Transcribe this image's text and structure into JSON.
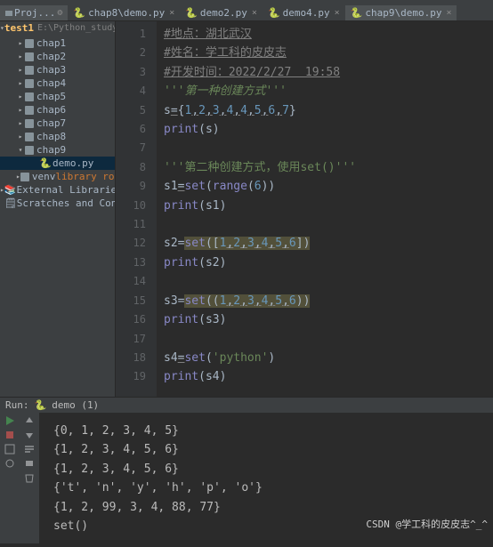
{
  "toolbar": {
    "project_label": "Proj..."
  },
  "tabs": [
    {
      "label": "chap8\\demo.py"
    },
    {
      "label": "demo2.py"
    },
    {
      "label": "demo4.py"
    },
    {
      "label": "chap9\\demo.py",
      "active": true
    }
  ],
  "tree": {
    "root": {
      "name": "test1",
      "path": "E:\\Python_study\\te"
    },
    "items": [
      {
        "name": "chap1"
      },
      {
        "name": "chap2"
      },
      {
        "name": "chap3"
      },
      {
        "name": "chap4"
      },
      {
        "name": "chap5"
      },
      {
        "name": "chap6"
      },
      {
        "name": "chap7"
      },
      {
        "name": "chap8"
      },
      {
        "name": "chap9",
        "open": true,
        "children": [
          {
            "name": "demo.py",
            "selected": true
          }
        ]
      }
    ],
    "venv": {
      "name": "venv",
      "suffix": "library root"
    },
    "ext": "External Libraries",
    "scratches": "Scratches and Consoles"
  },
  "gutter": [
    "1",
    "2",
    "3",
    "4",
    "5",
    "6",
    "7",
    "8",
    "9",
    "10",
    "11",
    "12",
    "13",
    "14",
    "15",
    "16",
    "17",
    "18",
    "19"
  ],
  "code": {
    "l1a": "#地点：湖北武汉",
    "l2a": "#姓名：学工科的皮皮志",
    "l3a": "#开发时间：2022/2/27  19:58",
    "l4": "'''第一种创建方式'''",
    "l5_var": "s",
    "eq": "=",
    "br_l": "{",
    "br_r": "}",
    "comma": ",",
    "n1": "1",
    "n2": "2",
    "n3": "3",
    "n4": "4",
    "n4b": "4",
    "n5": "5",
    "n6": "6",
    "n7": "7",
    "print": "print",
    "lp": "(",
    "rp": ")",
    "s": "s",
    "l8": "'''第二种创建方式，使用set()'''",
    "s1": "s1",
    "s2": "s2",
    "s3": "s3",
    "s4": "s4",
    "set": "set",
    "range": "range",
    "sq_l": "[",
    "sq_r": "]",
    "n6b": "6",
    "str_py": "'python'"
  },
  "run": {
    "label": "Run:",
    "config": "demo (1)",
    "lines": [
      "{0, 1, 2, 3, 4, 5}",
      "{1, 2, 3, 4, 5, 6}",
      "{1, 2, 3, 4, 5, 6}",
      "{'t', 'n', 'y', 'h', 'p', 'o'}",
      "{1, 2, 99, 3, 4, 88, 77}",
      "set()"
    ]
  },
  "watermark": "CSDN @学工科的皮皮志^_^"
}
